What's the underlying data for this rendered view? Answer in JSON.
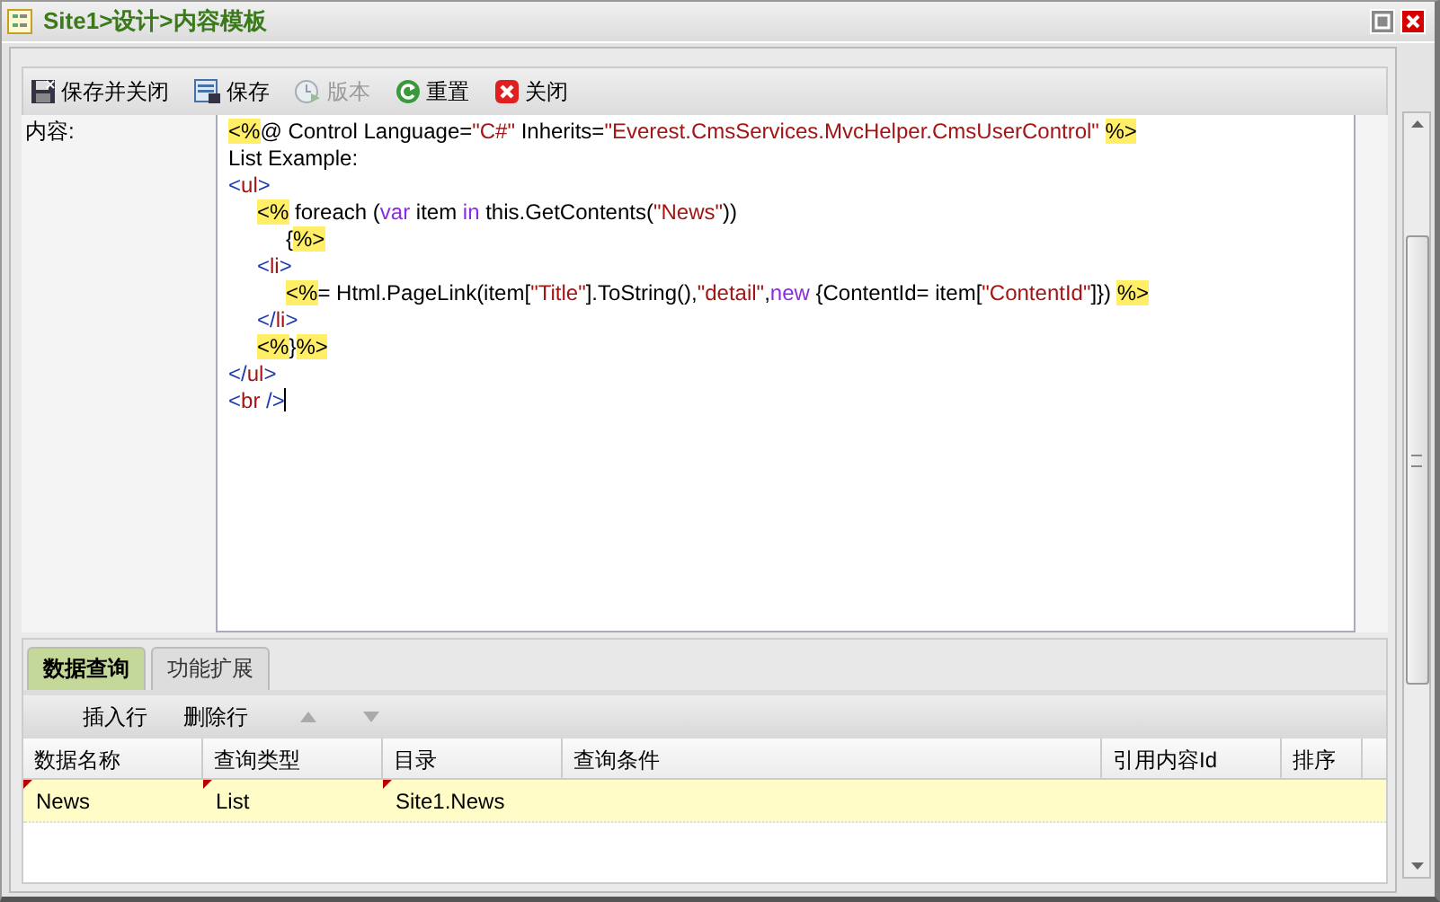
{
  "window": {
    "title": "Site1>设计>内容模板"
  },
  "toolbar": [
    {
      "label": "保存并关闭",
      "disabled": false
    },
    {
      "label": "保存",
      "disabled": false
    },
    {
      "label": "版本",
      "disabled": true
    },
    {
      "label": "重置",
      "disabled": false
    },
    {
      "label": "关闭",
      "disabled": false
    }
  ],
  "content_label": "内容:",
  "code_lines": [
    {
      "tokens": [
        {
          "kind": "asp",
          "text": "<%"
        },
        {
          "kind": "plain",
          "text": "@ Control Language="
        },
        {
          "kind": "str",
          "text": "\"C#\""
        },
        {
          "kind": "plain",
          "text": " Inherits="
        },
        {
          "kind": "str",
          "text": "\"Everest.CmsServices.MvcHelper.CmsUserControl\" "
        },
        {
          "kind": "asp",
          "text": "%>"
        }
      ]
    },
    {
      "tokens": [
        {
          "kind": "plain",
          "text": "List Example:"
        }
      ]
    },
    {
      "tokens": [
        {
          "kind": "delim",
          "text": "<"
        },
        {
          "kind": "tagname",
          "text": "ul"
        },
        {
          "kind": "delim",
          "text": ">"
        }
      ],
      "children": [
        {
          "tokens": [
            {
              "kind": "asp",
              "text": "<%"
            },
            {
              "kind": "plain",
              "text": " foreach ("
            },
            {
              "kind": "kw",
              "text": "var"
            },
            {
              "kind": "plain",
              "text": " item "
            },
            {
              "kind": "kw",
              "text": "in"
            },
            {
              "kind": "plain",
              "text": " this.GetContents("
            },
            {
              "kind": "str",
              "text": "\"News\""
            },
            {
              "kind": "plain",
              "text": "))"
            }
          ],
          "children": [
            {
              "tokens": [
                {
                  "kind": "plain",
                  "text": "{"
                },
                {
                  "kind": "asp",
                  "text": "%>"
                }
              ]
            }
          ]
        },
        {
          "tokens": [
            {
              "kind": "delim",
              "text": "<"
            },
            {
              "kind": "tagname",
              "text": "li"
            },
            {
              "kind": "delim",
              "text": ">"
            }
          ],
          "children": [
            {
              "tokens": [
                {
                  "kind": "asp",
                  "text": "<%"
                },
                {
                  "kind": "plain",
                  "text": "= Html.PageLink(item["
                },
                {
                  "kind": "str",
                  "text": "\"Title\""
                },
                {
                  "kind": "plain",
                  "text": "].ToString(),"
                },
                {
                  "kind": "str",
                  "text": "\"detail\""
                },
                {
                  "kind": "plain",
                  "text": ","
                },
                {
                  "kind": "kw",
                  "text": "new"
                },
                {
                  "kind": "plain",
                  "text": " {ContentId= item["
                },
                {
                  "kind": "str",
                  "text": "\"ContentId\""
                },
                {
                  "kind": "plain",
                  "text": "]}) "
                },
                {
                  "kind": "asp",
                  "text": "%>"
                }
              ]
            }
          ]
        },
        {
          "tokens": [
            {
              "kind": "delim",
              "text": "</"
            },
            {
              "kind": "tagname",
              "text": "li"
            },
            {
              "kind": "delim",
              "text": ">"
            }
          ]
        },
        {
          "tokens": [
            {
              "kind": "asp",
              "text": "<%"
            },
            {
              "kind": "plain",
              "text": "}"
            },
            {
              "kind": "asp",
              "text": "%>"
            }
          ]
        }
      ]
    },
    {
      "tokens": [
        {
          "kind": "delim",
          "text": "</"
        },
        {
          "kind": "tagname",
          "text": "ul"
        },
        {
          "kind": "delim",
          "text": ">"
        }
      ]
    },
    {
      "tokens": [
        {
          "kind": "delim",
          "text": "<"
        },
        {
          "kind": "tagname",
          "text": "br"
        },
        {
          "kind": "delim",
          "text": " />"
        }
      ],
      "cursor": true
    }
  ],
  "tabs": [
    {
      "label": "数据查询",
      "selected": true
    },
    {
      "label": "功能扩展",
      "selected": false
    }
  ],
  "grid_toolbar": {
    "insert": "插入行",
    "delete": "删除行"
  },
  "table": {
    "columns": [
      "数据名称",
      "查询类型",
      "目录",
      "查询条件",
      "引用内容Id",
      "排序"
    ],
    "rows": [
      {
        "cells": [
          "News",
          "List",
          "Site1.News",
          "",
          "",
          ""
        ],
        "selected": true
      }
    ]
  }
}
